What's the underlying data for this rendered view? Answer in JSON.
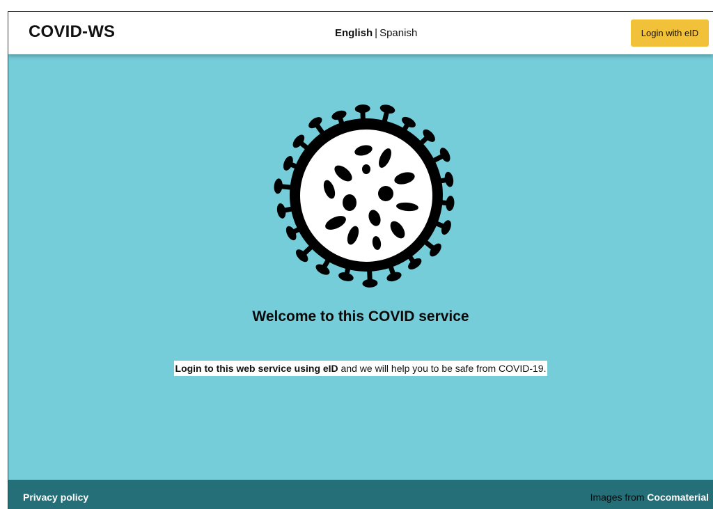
{
  "header": {
    "brand": "COVID-WS",
    "languages": {
      "active": "English",
      "separator": "|",
      "other": "Spanish"
    },
    "login_button": "Login with eID"
  },
  "hero": {
    "image_icon": "coronavirus-icon",
    "welcome": "Welcome to this COVID service"
  },
  "intro": {
    "bold": "Login to this web service using eID",
    "rest": " and we will help you to be safe from COVID-19."
  },
  "footer": {
    "privacy": "Privacy policy",
    "credits_prefix": "Images from ",
    "credits_link": "Cocomaterial"
  },
  "colors": {
    "background": "#75cdd9",
    "header": "#ffffff",
    "login_button": "#f2c13a",
    "footer": "#256f79"
  }
}
